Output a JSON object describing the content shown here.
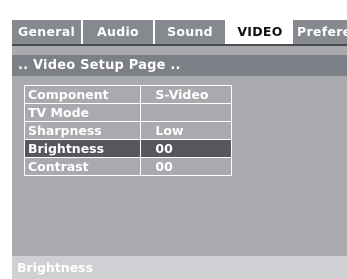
{
  "tabs": [
    "General",
    "Audio",
    "Sound",
    "VIDEO",
    "Preferen"
  ],
  "active_tab": "VIDEO",
  "page_title": ".. Video Setup Page ..",
  "menu": [
    {
      "label": "Component",
      "value": "S-Video"
    },
    {
      "label": "TV Mode",
      "value": ""
    },
    {
      "label": "Sharpness",
      "value": "Low"
    },
    {
      "label": "Brightness",
      "value": "00",
      "selected": true
    },
    {
      "label": "Contrast",
      "value": "00"
    }
  ],
  "status_text": "Brightness",
  "colors": {
    "screen_bg": "#a9aaae",
    "tabbar_bg": "#868990",
    "title_bg": "#7d7f86",
    "selected_row": "#55575c",
    "status_bg": "#cfd0d4"
  }
}
